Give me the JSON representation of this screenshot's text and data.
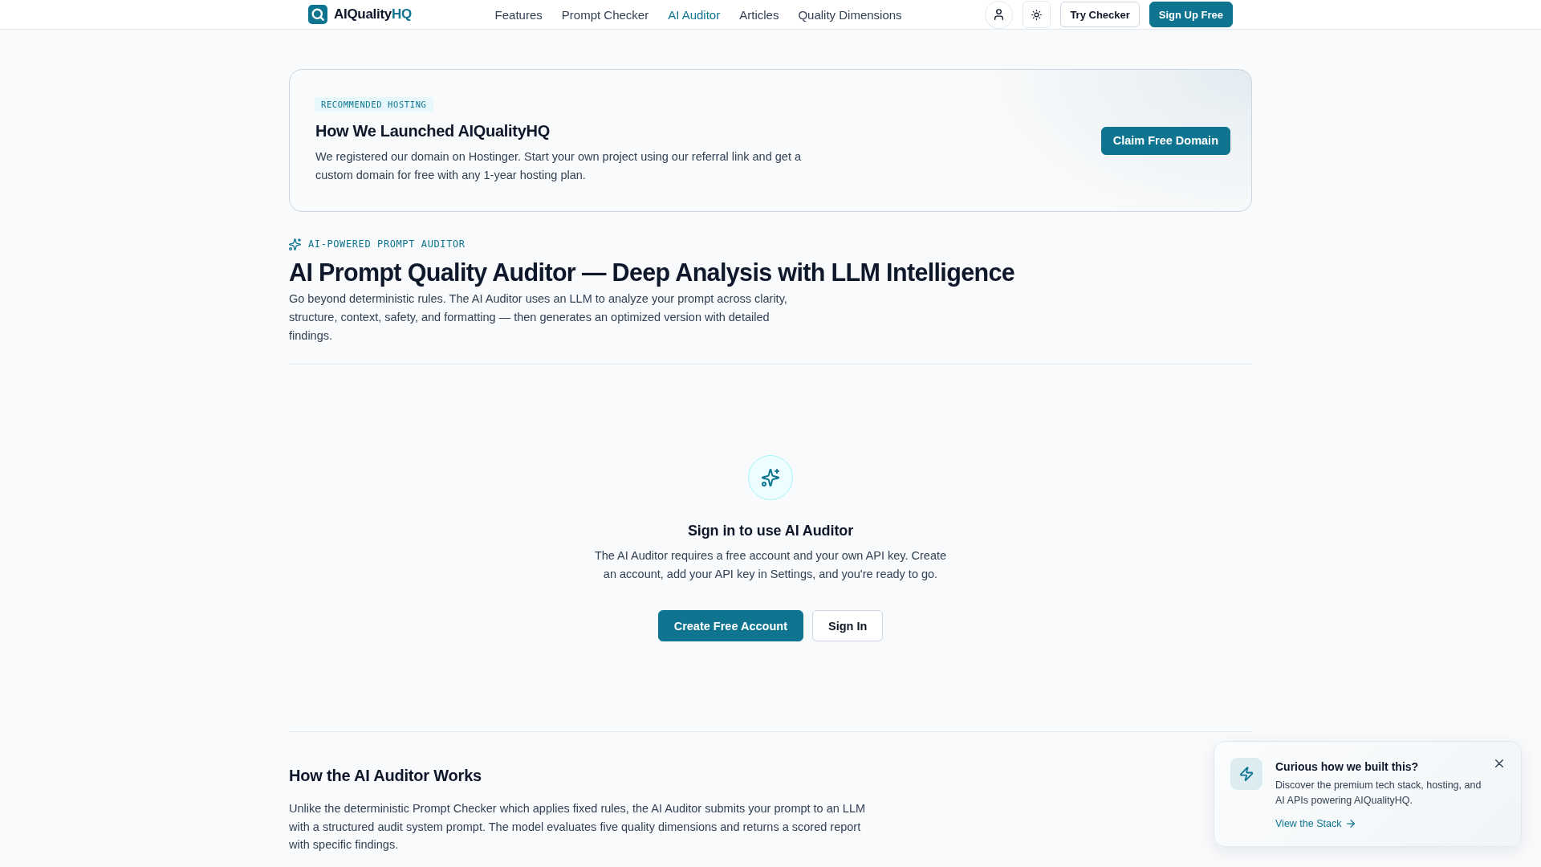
{
  "header": {
    "brand": {
      "name": "AIQuality",
      "accent": "HQ"
    },
    "nav": [
      {
        "label": "Features",
        "selected": false
      },
      {
        "label": "Prompt Checker",
        "selected": false
      },
      {
        "label": "AI Auditor",
        "selected": true
      },
      {
        "label": "Articles",
        "selected": false
      },
      {
        "label": "Quality Dimensions",
        "selected": false
      }
    ],
    "buttons": [
      {
        "label": "Try Checker",
        "kind": "outline"
      },
      {
        "label": "Sign Up Free",
        "kind": "primary"
      }
    ]
  },
  "banner": {
    "badge": "RECOMMENDED HOSTING",
    "title": "How We Launched AIQualityHQ",
    "text": "We registered our domain on Hostinger. Start your own project using our referral link and get a custom domain for free with any 1-year hosting plan.",
    "button": "Claim Free Domain"
  },
  "hero": {
    "eyebrow": "AI-POWERED PROMPT AUDITOR",
    "title": "AI Prompt Quality Auditor — Deep Analysis with LLM Intelligence",
    "text": "Go beyond deterministic rules. The AI Auditor uses an LLM to analyze your prompt across clarity, structure, context, safety, and formatting — then generates an optimized version with detailed findings."
  },
  "sign_in": {
    "title": "Sign in to use AI Auditor",
    "text": "The AI Auditor requires a free account and your own API key. Create an account, add your API key in Settings, and you're ready to go.",
    "buttons": [
      {
        "label": "Create Free Account",
        "kind": "primary"
      },
      {
        "label": "Sign In",
        "kind": "outline"
      }
    ]
  },
  "how_it_works": {
    "title": "How the AI Auditor Works",
    "text": "Unlike the deterministic Prompt Checker which applies fixed rules, the AI Auditor submits your prompt to an LLM with a structured audit system prompt. The model evaluates five quality dimensions and returns a scored report with specific findings."
  },
  "toast": {
    "title": "Curious how we built this?",
    "text": "Discover the premium tech stack, hosting, and AI APIs powering AIQualityHQ.",
    "link": "View the Stack"
  }
}
